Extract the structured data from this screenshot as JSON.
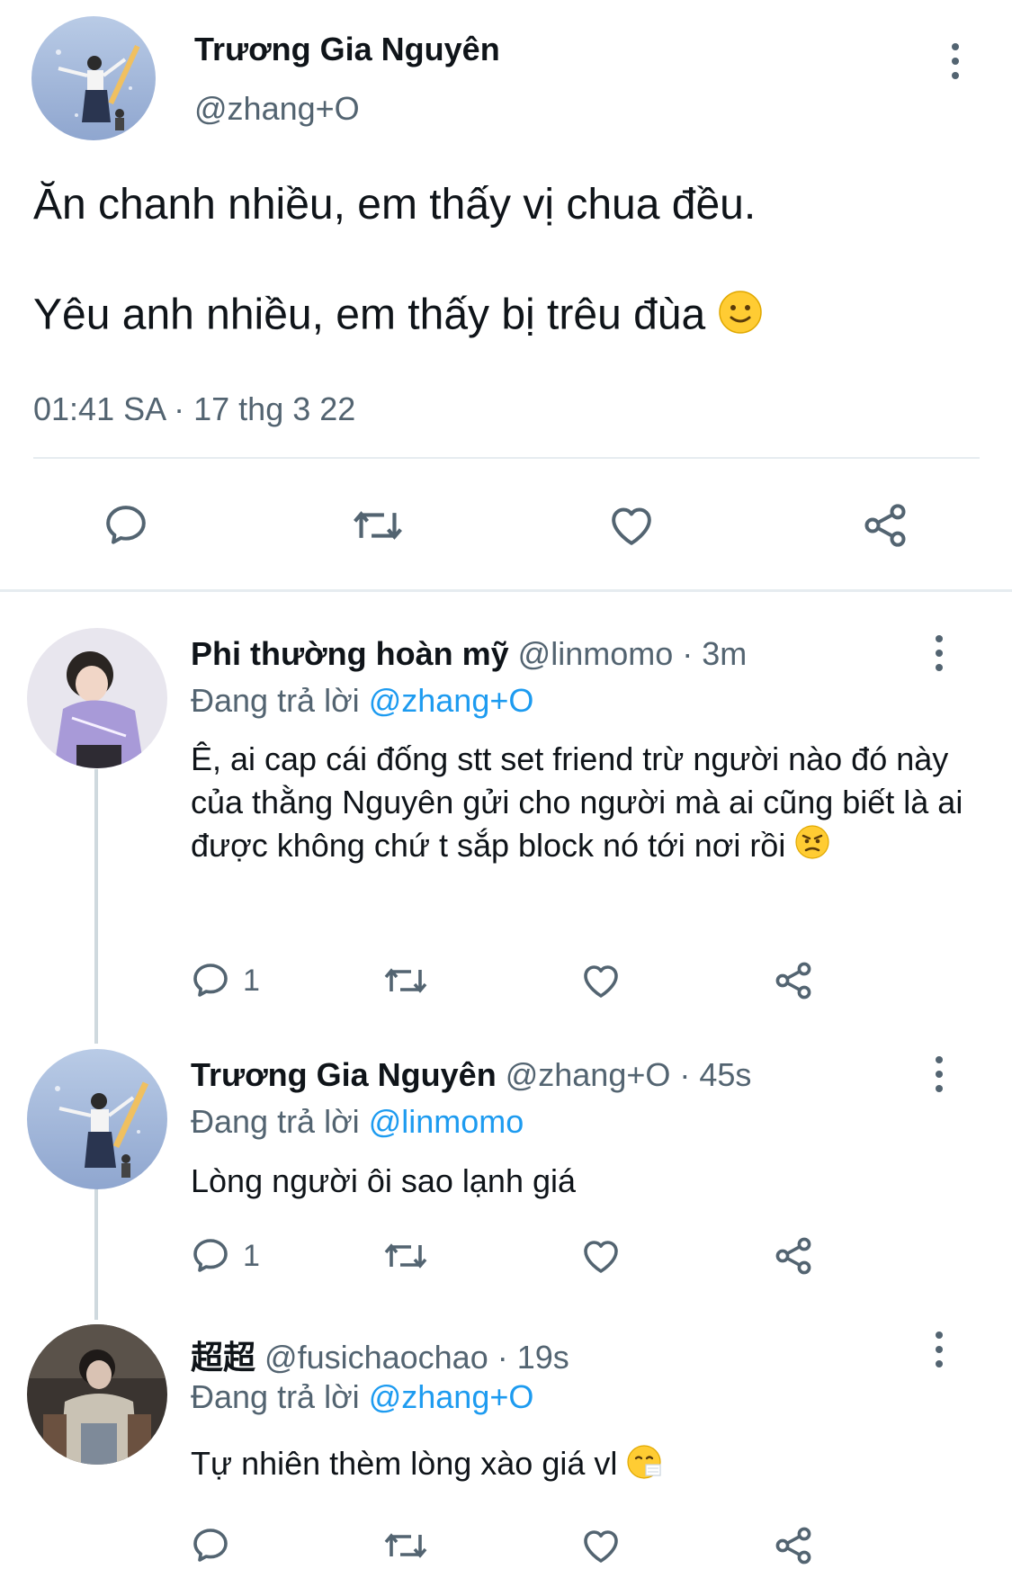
{
  "main_tweet": {
    "author_name": "Trương Gia Nguyên",
    "author_handle": "@zhang+O",
    "line1": "Ăn chanh nhiều, em thấy vị chua đều.",
    "line2": "Yêu anh nhiều, em thấy bị trêu đùa",
    "timestamp": "01:41 SA · 17 thg 3 22"
  },
  "replies": [
    {
      "name": "Phi thường hoàn mỹ",
      "handle": "@linmomo",
      "time": "· 3m",
      "replying_label": "Đang trả lời",
      "replying_to": "@zhang+O",
      "text": "Ê, ai cap cái đống stt set friend trừ người nào đó này của thằng Nguyên gửi cho người mà ai cũng biết là ai được không chứ t sắp block nó tới nơi rồi",
      "reply_count": "1"
    },
    {
      "name": "Trương Gia Nguyên",
      "handle": "@zhang+O",
      "time": "· 45s",
      "replying_label": "Đang trả lời",
      "replying_to": "@linmomo",
      "text": "Lòng người ôi sao lạnh giá",
      "reply_count": "1"
    },
    {
      "name": "超超",
      "handle": "@fusichaochao",
      "time": "· 19s",
      "replying_label": "Đang trả lời",
      "replying_to": "@zhang+O",
      "text": "Tự nhiên thèm lòng xào giá vl",
      "reply_count": ""
    }
  ],
  "icons": {
    "reply": "speech-bubble-icon",
    "retweet": "retweet-icon",
    "like": "heart-icon",
    "share": "share-icon",
    "more": "more-vertical-icon"
  },
  "colors": {
    "link": "#1d9bf0",
    "muted": "#536471",
    "text": "#0f1419"
  }
}
